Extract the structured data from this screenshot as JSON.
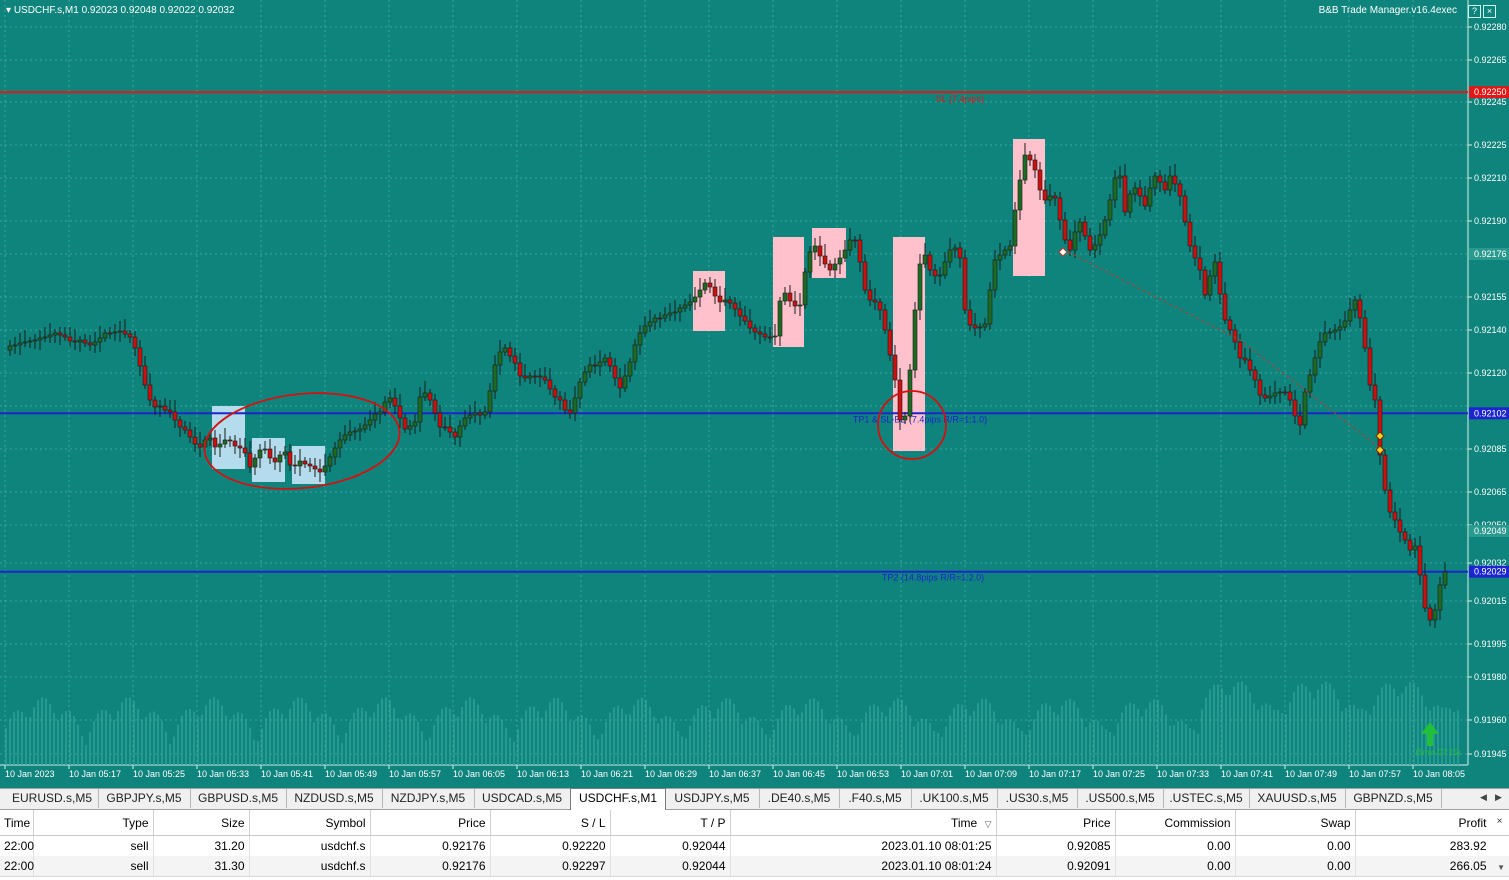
{
  "header": {
    "symbol_info": "USDCHF.s,M1  0.92023 0.92048 0.92022 0.92032",
    "ea_name": "B&B Trade Manager.v16.4exec"
  },
  "window_buttons": [
    "?",
    "×"
  ],
  "colors": {
    "background": "#0e847c",
    "bull_candle": "#1d6b22",
    "bear_candle": "#cc1010",
    "sl_line": "#e01818",
    "tp_line": "#1c26cc",
    "highlight_pink": "#ffc2cc",
    "highlight_blue": "#b4dcec",
    "annotation_red": "#d80f0f"
  },
  "price_axis": {
    "ticks": [
      "0.92280",
      "0.92265",
      "0.92245",
      "0.92225",
      "0.92210",
      "0.92190",
      "0.92155",
      "0.92140",
      "0.92120",
      "0.92085",
      "0.92065",
      "0.92050",
      "0.92032",
      "0.92015",
      "0.91995",
      "0.91980",
      "0.91960",
      "0.91945"
    ],
    "tags": [
      {
        "label": "0.92250",
        "kind": "sl"
      },
      {
        "label": "0.92176",
        "kind": "bid"
      },
      {
        "label": "0.92102",
        "kind": "tp"
      },
      {
        "label": "0.92049",
        "kind": "ask"
      },
      {
        "label": "0.92029",
        "kind": "tp"
      }
    ]
  },
  "time_axis": [
    "10 Jan 2023",
    "10 Jan 05:17",
    "10 Jan 05:25",
    "10 Jan 05:33",
    "10 Jan 05:41",
    "10 Jan 05:49",
    "10 Jan 05:57",
    "10 Jan 06:05",
    "10 Jan 06:13",
    "10 Jan 06:21",
    "10 Jan 06:29",
    "10 Jan 06:37",
    "10 Jan 06:45",
    "10 Jan 06:53",
    "10 Jan 07:01",
    "10 Jan 07:09",
    "10 Jan 07:17",
    "10 Jan 07:25",
    "10 Jan 07:33",
    "10 Jan 07:41",
    "10 Jan 07:49",
    "10 Jan 07:57",
    "10 Jan 08:05"
  ],
  "lines": {
    "sl": {
      "price": 0.9225,
      "label": "SL (7.4pips)"
    },
    "tp1": {
      "price": 0.92102,
      "label": "TP1 & SL-BE (7.4pips R/R=1:1.0)"
    },
    "tp2": {
      "price": 0.92029,
      "label": "TP2 (14.8pips R/R=1:2.0)"
    }
  },
  "timer_label": "(5min 07:15)",
  "tabs": [
    {
      "label": "EURUSD.s,M5",
      "active": false
    },
    {
      "label": "GBPJPY.s,M5",
      "active": false
    },
    {
      "label": "GBPUSD.s,M5",
      "active": false
    },
    {
      "label": "NZDUSD.s,M5",
      "active": false
    },
    {
      "label": "NZDJPY.s,M5",
      "active": false
    },
    {
      "label": "USDCAD.s,M5",
      "active": false
    },
    {
      "label": "USDCHF.s,M1",
      "active": true
    },
    {
      "label": "USDJPY.s,M5",
      "active": false
    },
    {
      "label": ".DE40.s,M5",
      "active": false
    },
    {
      "label": ".F40.s,M5",
      "active": false
    },
    {
      "label": ".UK100.s,M5",
      "active": false
    },
    {
      "label": ".US30.s,M5",
      "active": false
    },
    {
      "label": ".US500.s,M5",
      "active": false
    },
    {
      "label": ".USTEC.s,M5",
      "active": false
    },
    {
      "label": "XAUUSD.s,M5",
      "active": false
    },
    {
      "label": "GBPNZD.s,M5",
      "active": false
    }
  ],
  "trades": {
    "columns": [
      "Time",
      "Type",
      "Size",
      "Symbol",
      "Price",
      "S / L",
      "T / P",
      "Time",
      "Price",
      "Commission",
      "Swap",
      "Profit"
    ],
    "sort_indicator": "▽",
    "rows": [
      [
        "22:00",
        "sell",
        "31.20",
        "usdchf.s",
        "0.92176",
        "0.92220",
        "0.92044",
        "2023.01.10 08:01:25",
        "0.92085",
        "0.00",
        "0.00",
        "283.92"
      ],
      [
        "22:00",
        "sell",
        "31.30",
        "usdchf.s",
        "0.92176",
        "0.92297",
        "0.92044",
        "2023.01.10 08:01:24",
        "0.92091",
        "0.00",
        "0.00",
        "266.05"
      ]
    ]
  },
  "pane_close": "×"
}
